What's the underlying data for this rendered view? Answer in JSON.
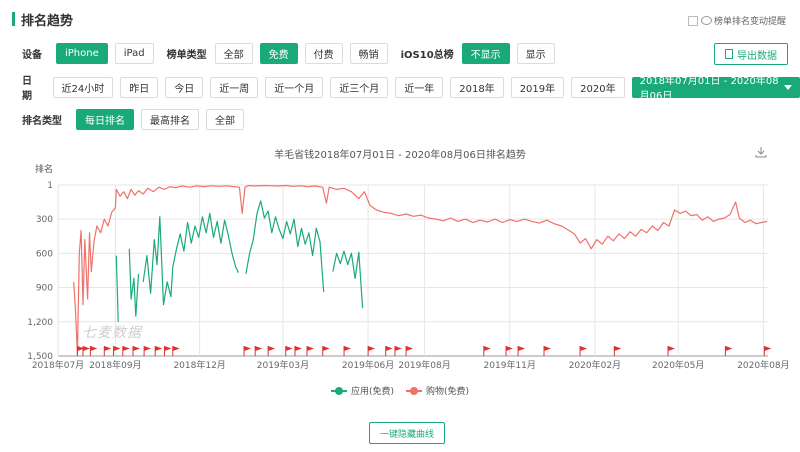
{
  "page": {
    "title": "排名趋势"
  },
  "alert_toggle": {
    "label": "榜单排名变动提醒",
    "checked": false
  },
  "device": {
    "label": "设备",
    "options": [
      "iPhone",
      "iPad"
    ],
    "selected": "iPhone"
  },
  "chart_type": {
    "label": "榜单类型",
    "options": [
      "全部",
      "免费",
      "付费",
      "畅销"
    ],
    "selected": "免费"
  },
  "ios10": {
    "label": "iOS10总榜",
    "options": [
      "不显示",
      "显示"
    ],
    "selected": "不显示"
  },
  "export": {
    "label": "导出数据"
  },
  "date": {
    "label": "日期",
    "options": [
      "近24小时",
      "昨日",
      "今日",
      "近一周",
      "近一个月",
      "近三个月",
      "近一年",
      "2018年",
      "2019年",
      "2020年"
    ],
    "range": "2018年07月01日 - 2020年08月06日"
  },
  "rank_type": {
    "label": "排名类型",
    "options": [
      "每日排名",
      "最高排名",
      "全部"
    ],
    "selected": "每日排名"
  },
  "chart_title": "羊毛省钱2018年07月01日 - 2020年08月06日排名趋势",
  "watermark": "七麦数据",
  "legend": [
    {
      "name": "应用(免费)",
      "color": "#1aaa7a"
    },
    {
      "name": "购物(免费)",
      "color": "#f0716a"
    }
  ],
  "hide_button": {
    "label": "一键隐藏曲线"
  },
  "colors": {
    "accent": "#1aaa7a",
    "series_app": "#1aaa7a",
    "series_shopping": "#f0716a",
    "flag": "#e03030"
  },
  "chart_data": {
    "type": "line",
    "ylabel": "排名",
    "ylim": [
      1500,
      1
    ],
    "yticks": [
      1,
      300,
      600,
      900,
      1200,
      1500
    ],
    "xlim": [
      "2018-07-01",
      "2020-08-06"
    ],
    "xticks": [
      "2018年07月",
      "2018年09月",
      "2018年12月",
      "2019年03月",
      "2019年06月",
      "2019年08月",
      "2019年11月",
      "2020年02月",
      "2020年05月",
      "2020年08月"
    ],
    "xtick_dates": [
      "2018-07-01",
      "2018-09-01",
      "2018-12-01",
      "2019-03-01",
      "2019-06-01",
      "2019-08-01",
      "2019-11-01",
      "2020-02-01",
      "2020-05-01",
      "2020-08-01"
    ],
    "series": [
      {
        "name": "应用(免费)",
        "color": "#1aaa7a",
        "segments": [
          [
            [
              "2018-09-02",
              620
            ],
            [
              "2018-09-04",
              1200
            ]
          ],
          [
            [
              "2018-09-16",
              560
            ],
            [
              "2018-09-18",
              1000
            ],
            [
              "2018-09-21",
              820
            ],
            [
              "2018-09-23",
              1150
            ],
            [
              "2018-09-26",
              780
            ]
          ],
          [
            [
              "2018-10-01",
              850
            ],
            [
              "2018-10-05",
              620
            ],
            [
              "2018-10-09",
              950
            ],
            [
              "2018-10-13",
              480
            ],
            [
              "2018-10-16",
              700
            ],
            [
              "2018-10-19",
              280
            ],
            [
              "2018-10-23",
              1050
            ],
            [
              "2018-10-27",
              850
            ],
            [
              "2018-10-31",
              980
            ],
            [
              "2018-11-02",
              720
            ],
            [
              "2018-11-06",
              560
            ],
            [
              "2018-11-10",
              430
            ],
            [
              "2018-11-14",
              580
            ],
            [
              "2018-11-18",
              330
            ],
            [
              "2018-11-22",
              510
            ],
            [
              "2018-11-26",
              360
            ],
            [
              "2018-11-30",
              460
            ],
            [
              "2018-12-04",
              280
            ],
            [
              "2018-12-08",
              420
            ],
            [
              "2018-12-12",
              250
            ],
            [
              "2018-12-16",
              460
            ],
            [
              "2018-12-20",
              320
            ],
            [
              "2018-12-24",
              510
            ],
            [
              "2018-12-28",
              310
            ],
            [
              "2019-01-01",
              440
            ],
            [
              "2019-01-05",
              600
            ],
            [
              "2019-01-09",
              720
            ],
            [
              "2019-01-12",
              770
            ]
          ],
          [
            [
              "2019-01-20",
              780
            ],
            [
              "2019-01-24",
              600
            ],
            [
              "2019-01-28",
              480
            ],
            [
              "2019-02-01",
              250
            ],
            [
              "2019-02-05",
              140
            ],
            [
              "2019-02-09",
              290
            ],
            [
              "2019-02-13",
              230
            ],
            [
              "2019-02-17",
              420
            ],
            [
              "2019-02-21",
              280
            ],
            [
              "2019-02-25",
              390
            ],
            [
              "2019-03-01",
              470
            ],
            [
              "2019-03-05",
              320
            ],
            [
              "2019-03-09",
              430
            ],
            [
              "2019-03-13",
              300
            ],
            [
              "2019-03-17",
              540
            ],
            [
              "2019-03-21",
              380
            ],
            [
              "2019-03-25",
              520
            ],
            [
              "2019-03-29",
              420
            ],
            [
              "2019-04-02",
              620
            ],
            [
              "2019-04-06",
              380
            ],
            [
              "2019-04-10",
              500
            ],
            [
              "2019-04-14",
              940
            ]
          ],
          [
            [
              "2019-04-24",
              760
            ],
            [
              "2019-04-28",
              600
            ],
            [
              "2019-05-02",
              690
            ],
            [
              "2019-05-06",
              580
            ],
            [
              "2019-05-10",
              700
            ],
            [
              "2019-05-14",
              600
            ],
            [
              "2019-05-18",
              820
            ],
            [
              "2019-05-22",
              590
            ],
            [
              "2019-05-26",
              1080
            ]
          ]
        ]
      },
      {
        "name": "购物(免费)",
        "color": "#f0716a",
        "segments": [
          [
            [
              "2018-07-18",
              850
            ],
            [
              "2018-07-20",
              1120
            ],
            [
              "2018-07-22",
              1490
            ],
            [
              "2018-07-24",
              600
            ],
            [
              "2018-07-26",
              400
            ],
            [
              "2018-07-28",
              1050
            ],
            [
              "2018-07-30",
              480
            ],
            [
              "2018-08-02",
              1000
            ],
            [
              "2018-08-04",
              420
            ],
            [
              "2018-08-06",
              760
            ],
            [
              "2018-08-09",
              490
            ],
            [
              "2018-08-12",
              360
            ],
            [
              "2018-08-16",
              420
            ],
            [
              "2018-08-20",
              300
            ],
            [
              "2018-08-24",
              360
            ],
            [
              "2018-08-28",
              240
            ],
            [
              "2018-09-01",
              200
            ],
            [
              "2018-09-02",
              40
            ],
            [
              "2018-09-06",
              100
            ],
            [
              "2018-09-10",
              60
            ],
            [
              "2018-09-14",
              120
            ],
            [
              "2018-09-18",
              40
            ],
            [
              "2018-09-22",
              90
            ],
            [
              "2018-09-26",
              50
            ],
            [
              "2018-10-01",
              80
            ],
            [
              "2018-10-06",
              30
            ],
            [
              "2018-10-12",
              60
            ],
            [
              "2018-10-18",
              20
            ],
            [
              "2018-10-24",
              40
            ],
            [
              "2018-10-30",
              15
            ],
            [
              "2018-11-05",
              25
            ],
            [
              "2018-11-12",
              10
            ],
            [
              "2018-11-20",
              20
            ],
            [
              "2018-11-28",
              8
            ],
            [
              "2018-12-06",
              15
            ],
            [
              "2018-12-14",
              8
            ],
            [
              "2018-12-22",
              12
            ],
            [
              "2018-12-30",
              8
            ],
            [
              "2019-01-07",
              15
            ],
            [
              "2019-01-13",
              20
            ],
            [
              "2019-01-16",
              250
            ],
            [
              "2019-01-19",
              20
            ],
            [
              "2019-01-23",
              5
            ],
            [
              "2019-01-30",
              10
            ],
            [
              "2019-02-08",
              5
            ],
            [
              "2019-02-16",
              8
            ],
            [
              "2019-02-24",
              10
            ],
            [
              "2019-03-04",
              5
            ],
            [
              "2019-03-12",
              12
            ],
            [
              "2019-03-20",
              8
            ],
            [
              "2019-03-28",
              15
            ],
            [
              "2019-04-05",
              10
            ],
            [
              "2019-04-13",
              20
            ],
            [
              "2019-04-17",
              160
            ],
            [
              "2019-04-20",
              20
            ],
            [
              "2019-04-28",
              40
            ],
            [
              "2019-05-06",
              30
            ],
            [
              "2019-05-14",
              60
            ],
            [
              "2019-05-22",
              120
            ],
            [
              "2019-05-28",
              60
            ],
            [
              "2019-06-03",
              180
            ],
            [
              "2019-06-10",
              220
            ],
            [
              "2019-06-18",
              240
            ],
            [
              "2019-06-26",
              250
            ],
            [
              "2019-07-04",
              270
            ],
            [
              "2019-07-12",
              255
            ],
            [
              "2019-07-20",
              275
            ],
            [
              "2019-07-28",
              265
            ],
            [
              "2019-08-05",
              290
            ],
            [
              "2019-08-13",
              300
            ],
            [
              "2019-08-21",
              315
            ],
            [
              "2019-08-29",
              290
            ],
            [
              "2019-09-06",
              320
            ],
            [
              "2019-09-14",
              300
            ],
            [
              "2019-09-22",
              330
            ],
            [
              "2019-09-30",
              310
            ],
            [
              "2019-10-08",
              325
            ],
            [
              "2019-10-16",
              300
            ],
            [
              "2019-10-24",
              330
            ],
            [
              "2019-11-01",
              305
            ],
            [
              "2019-11-09",
              320
            ],
            [
              "2019-11-17",
              300
            ],
            [
              "2019-11-25",
              320
            ],
            [
              "2019-12-03",
              335
            ],
            [
              "2019-12-11",
              310
            ],
            [
              "2019-12-19",
              340
            ],
            [
              "2019-12-27",
              360
            ],
            [
              "2020-01-04",
              400
            ],
            [
              "2020-01-10",
              430
            ],
            [
              "2020-01-16",
              510
            ],
            [
              "2020-01-22",
              470
            ],
            [
              "2020-01-28",
              560
            ],
            [
              "2020-02-03",
              480
            ],
            [
              "2020-02-09",
              520
            ],
            [
              "2020-02-15",
              450
            ],
            [
              "2020-02-21",
              490
            ],
            [
              "2020-02-27",
              430
            ],
            [
              "2020-03-04",
              470
            ],
            [
              "2020-03-10",
              410
            ],
            [
              "2020-03-16",
              450
            ],
            [
              "2020-03-22",
              390
            ],
            [
              "2020-03-28",
              420
            ],
            [
              "2020-04-03",
              360
            ],
            [
              "2020-04-09",
              400
            ],
            [
              "2020-04-15",
              330
            ],
            [
              "2020-04-21",
              360
            ],
            [
              "2020-04-27",
              220
            ],
            [
              "2020-05-03",
              250
            ],
            [
              "2020-05-09",
              230
            ],
            [
              "2020-05-15",
              270
            ],
            [
              "2020-05-21",
              260
            ],
            [
              "2020-05-27",
              310
            ],
            [
              "2020-06-02",
              280
            ],
            [
              "2020-06-08",
              320
            ],
            [
              "2020-06-14",
              300
            ],
            [
              "2020-06-20",
              290
            ],
            [
              "2020-06-26",
              260
            ],
            [
              "2020-07-02",
              150
            ],
            [
              "2020-07-06",
              290
            ],
            [
              "2020-07-12",
              330
            ],
            [
              "2020-07-18",
              310
            ],
            [
              "2020-07-24",
              340
            ],
            [
              "2020-07-30",
              330
            ],
            [
              "2020-08-05",
              320
            ]
          ]
        ]
      }
    ],
    "flags": [
      "2018-07-22",
      "2018-07-28",
      "2018-08-05",
      "2018-08-20",
      "2018-08-30",
      "2018-09-09",
      "2018-09-20",
      "2018-10-02",
      "2018-10-14",
      "2018-10-24",
      "2018-11-02",
      "2019-01-18",
      "2019-01-30",
      "2019-02-13",
      "2019-03-04",
      "2019-03-14",
      "2019-03-27",
      "2019-04-13",
      "2019-05-06",
      "2019-06-01",
      "2019-06-20",
      "2019-06-30",
      "2019-07-12",
      "2019-10-04",
      "2019-10-28",
      "2019-11-10",
      "2019-12-08",
      "2020-01-16",
      "2020-02-22",
      "2020-04-20",
      "2020-06-21",
      "2020-08-02"
    ]
  }
}
